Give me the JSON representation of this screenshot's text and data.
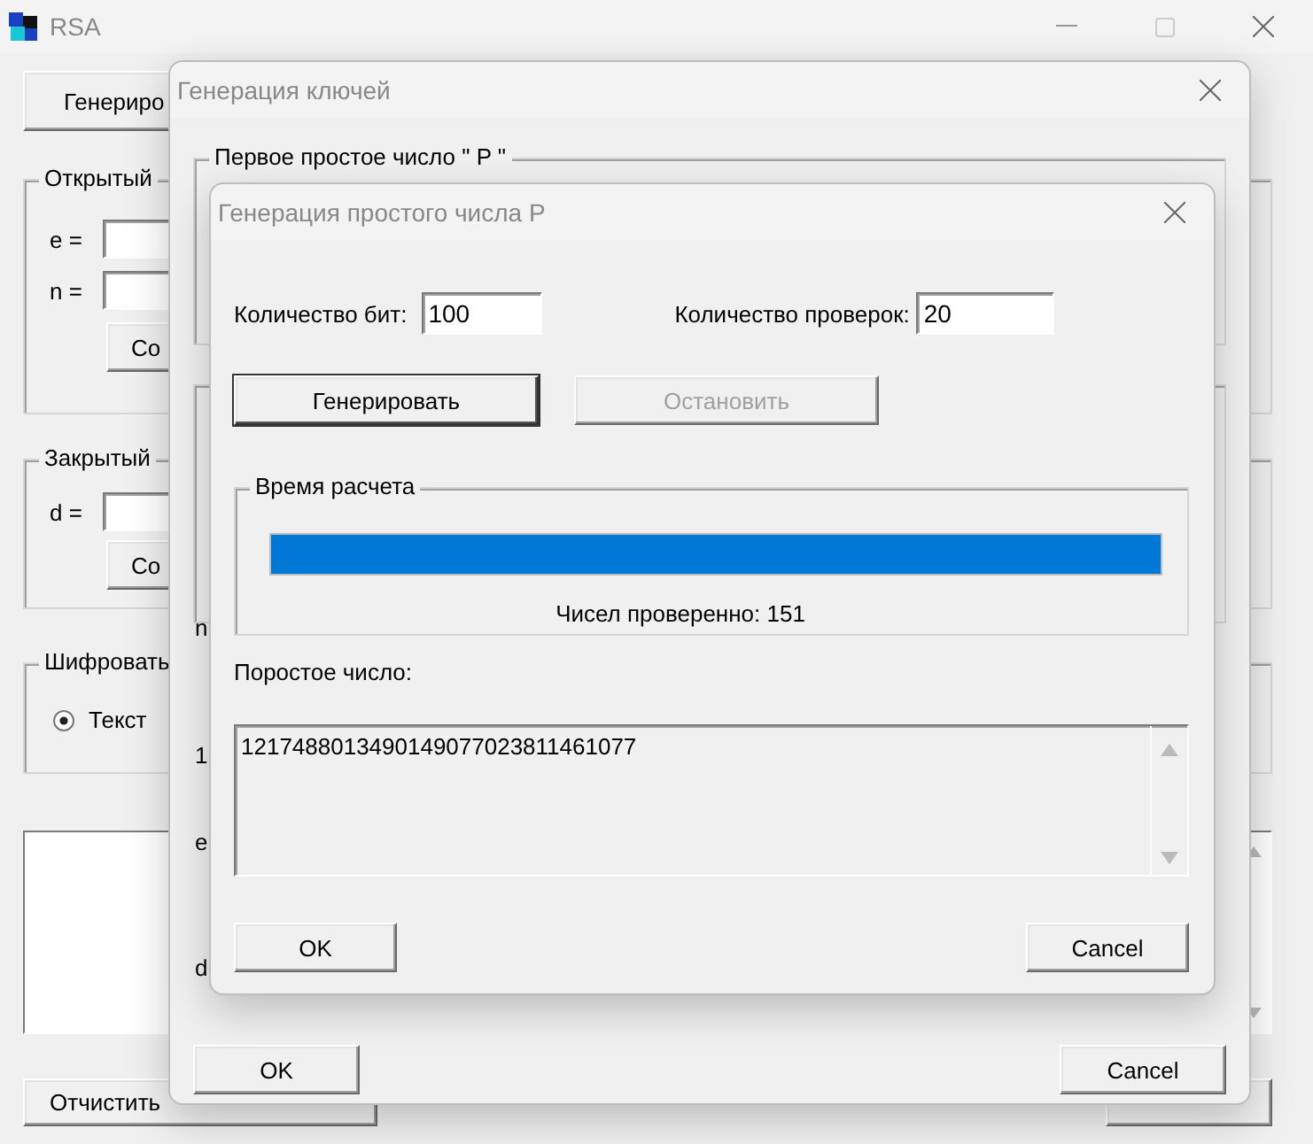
{
  "main_window": {
    "title": "RSA",
    "generate_button": "Генериро",
    "public_key": {
      "legend": "Открытый",
      "fields": [
        {
          "label": "e ="
        },
        {
          "label": "n ="
        }
      ],
      "save_button": "Со"
    },
    "private_key": {
      "legend": "Закрытый",
      "fields": [
        {
          "label": "d ="
        }
      ],
      "save_button": "Со"
    },
    "encrypt": {
      "legend": "Шифровать",
      "options": [
        {
          "label": "Текст",
          "selected": true
        }
      ]
    },
    "clear_button": "Отчистить"
  },
  "key_dialog": {
    "title": "Генерация ключей",
    "group_p_legend": "Первое простое число  \" P \"",
    "side_labels": [
      "n",
      "1",
      "e",
      "d"
    ],
    "ok_button": "OK",
    "cancel_button": "Cancel"
  },
  "prime_dialog": {
    "title": "Генерация простого числа P",
    "fields": [
      {
        "label": "Количество бит:",
        "value": "100"
      },
      {
        "label": "Количество проверок:",
        "value": "20"
      }
    ],
    "buttons": [
      {
        "label": "Генерировать",
        "disabled": false,
        "focused": true
      },
      {
        "label": "Остановить",
        "disabled": true,
        "focused": false
      }
    ],
    "progress": {
      "legend": "Время расчета",
      "level": 1,
      "caption": "Чисел проверенно: 151"
    },
    "result_label": "Поростое число:",
    "result": "1217488013490149077023811461077",
    "ok_button": "OK",
    "cancel_button": "Cancel"
  }
}
